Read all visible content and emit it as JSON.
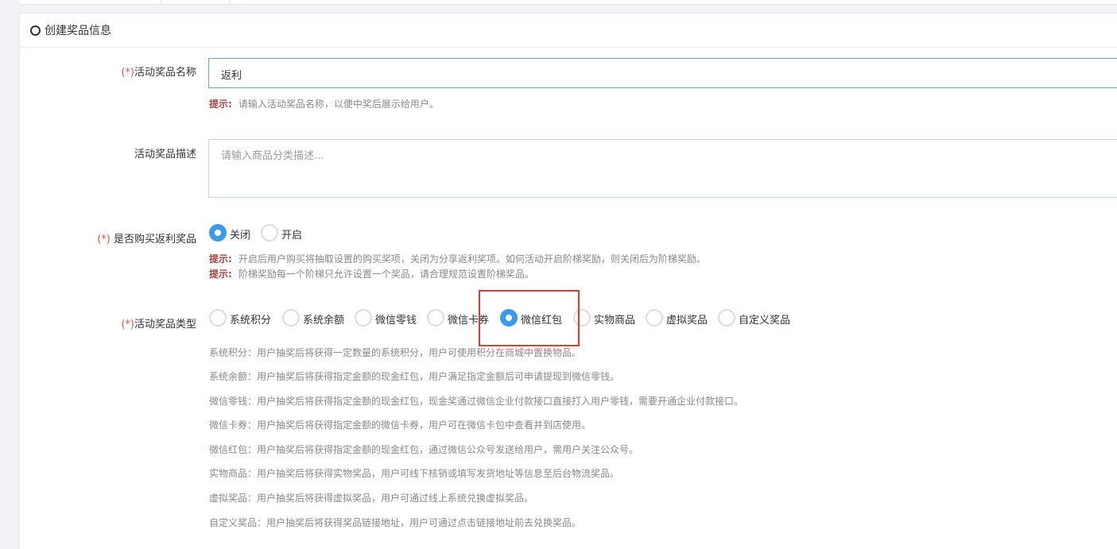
{
  "section": {
    "title": "创建奖品信息"
  },
  "prize_name": {
    "required_mark": "(*)",
    "label": "活动奖品名称",
    "value": "返利",
    "hint_title": "提示:",
    "hint_text": "请输入活动奖品名称，以便中奖后展示给用户。"
  },
  "prize_desc": {
    "label": "活动奖品描述",
    "placeholder": "请输入商品分类描述..."
  },
  "rebate": {
    "required_mark": "(*)",
    "label": " 是否购买返利奖品",
    "options": [
      {
        "label": "关闭",
        "checked": true
      },
      {
        "label": "开启",
        "checked": false
      }
    ],
    "hints": [
      {
        "title": "提示:",
        "text": "开启后用户购买将抽取设置的购买奖项，关闭为分享返利奖项。如何活动开启阶梯奖励，则关闭后为阶梯奖励。"
      },
      {
        "title": "提示:",
        "text": "阶梯奖励每一个阶梯只允许设置一个奖品，请合理规范设置阶梯奖品。"
      }
    ]
  },
  "prize_type": {
    "required_mark": "(*)",
    "label": "活动奖品类型",
    "selected": "微信红包",
    "options": [
      {
        "label": "系统积分",
        "checked": false
      },
      {
        "label": "系统余额",
        "checked": false
      },
      {
        "label": "微信零钱",
        "checked": false
      },
      {
        "label": "微信卡券",
        "checked": false
      },
      {
        "label": "微信红包",
        "checked": true
      },
      {
        "label": "实物商品",
        "checked": false
      },
      {
        "label": "虚拟奖品",
        "checked": false
      },
      {
        "label": "自定义奖品",
        "checked": false
      }
    ],
    "descriptions": [
      "系统积分：用户抽奖后将获得一定数量的系统积分，用户可使用积分在商城中置换物品。",
      "系统余额：用户抽奖后将获得指定金额的现金红包，用户满足指定金额后可申请提现到微信零钱。",
      "微信零钱：用户抽奖后将获得指定金额的现金红包，现金奖通过微信企业付款接口直接打入用户零钱，需要开通企业付款接口。",
      "微信卡券：用户抽奖后将获得指定金额的微信卡券，用户可在微信卡包中查看并到店使用。",
      "微信红包：用户抽奖后将获得指定金额的现金红包，通过微信公众号发送给用户，需用户关注公众号。",
      "实物商品：用户抽奖后将获得实物奖品，用户可线下核销或填写发货地址等信息至后台物流奖品。",
      "虚拟奖品：用户抽奖后将获得虚拟奖品，用户可通过线上系统兑换虚拟奖品。",
      "自定义奖品：用户抽奖后将获得奖品链接地址，用户可通过点击链接地址前去兑换奖品。"
    ]
  },
  "colors": {
    "accent": "#3c9ae8",
    "required": "#d9534f",
    "hint_title": "#a94442",
    "highlight": "#e53935"
  }
}
